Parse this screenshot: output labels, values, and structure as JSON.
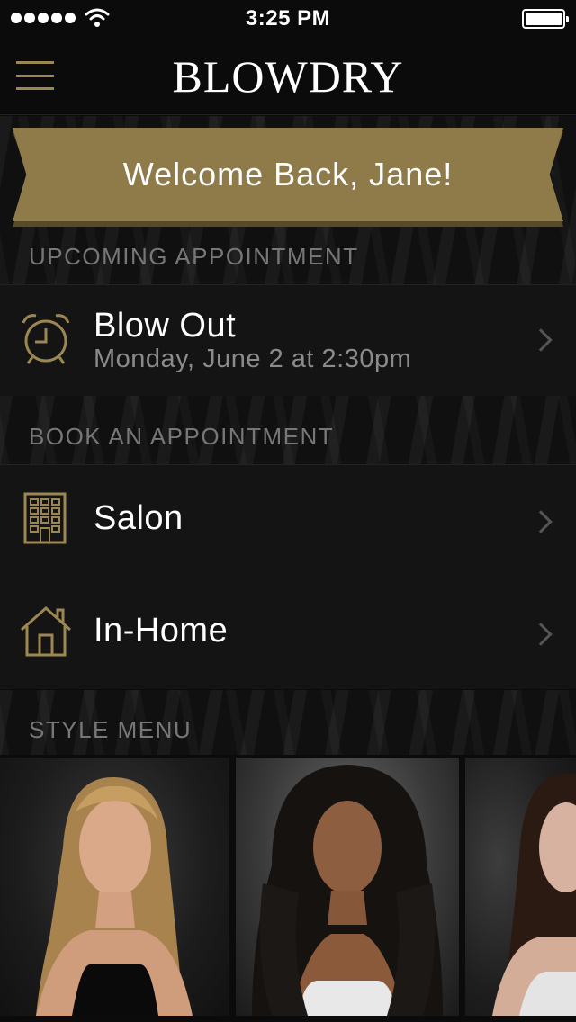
{
  "status_bar": {
    "time": "3:25 PM",
    "signal_bars": 5,
    "battery_level": 1.0
  },
  "nav": {
    "brand": "BLOWDRY",
    "menu_icon": "hamburger-menu-icon"
  },
  "banner": {
    "welcome_text": "Welcome Back, Jane!"
  },
  "upcoming": {
    "section_label": "UPCOMING APPOINTMENT",
    "icon": "alarm-clock-icon",
    "title": "Blow Out",
    "subtitle": "Monday, June 2 at 2:30pm"
  },
  "book": {
    "section_label": "BOOK AN APPOINTMENT",
    "items": [
      {
        "label": "Salon",
        "icon": "building-icon"
      },
      {
        "label": "In-Home",
        "icon": "house-icon"
      }
    ]
  },
  "style_menu": {
    "section_label": "STYLE MENU",
    "cards": [
      {
        "image": "model-blonde-long-waves"
      },
      {
        "image": "model-dark-voluminous-curls"
      },
      {
        "image": "model-brunette-straight"
      }
    ]
  },
  "colors": {
    "accent_gold": "#8f7a49",
    "icon_gold": "#9c8752",
    "background": "#0b0b0b",
    "row_background": "#141414",
    "muted_text": "#8b8b8b"
  }
}
